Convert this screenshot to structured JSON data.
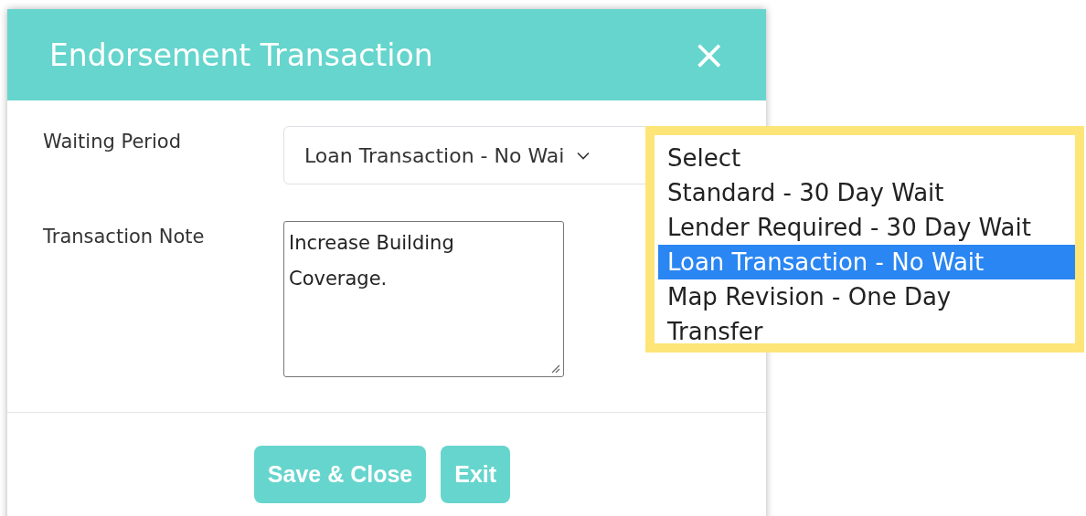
{
  "dialog": {
    "title": "Endorsement Transaction",
    "close": "×"
  },
  "fields": [
    {
      "label": "Waiting Period",
      "kind": "select",
      "value": "Loan Transaction - No Wai"
    },
    {
      "label": "Transaction Note",
      "kind": "textarea",
      "value": "Increase Building\nCoverage."
    }
  ],
  "dropdown": {
    "highlighted": true,
    "options": [
      {
        "label": "Select",
        "selected": false
      },
      {
        "label": "Standard - 30 Day Wait",
        "selected": false
      },
      {
        "label": "Lender Required - 30 Day Wait",
        "selected": false
      },
      {
        "label": "Loan Transaction - No Wait",
        "selected": true
      },
      {
        "label": "Map Revision - One Day",
        "selected": false
      },
      {
        "label": "Transfer",
        "selected": false
      }
    ]
  },
  "buttons": [
    "Save & Close",
    "Exit"
  ]
}
